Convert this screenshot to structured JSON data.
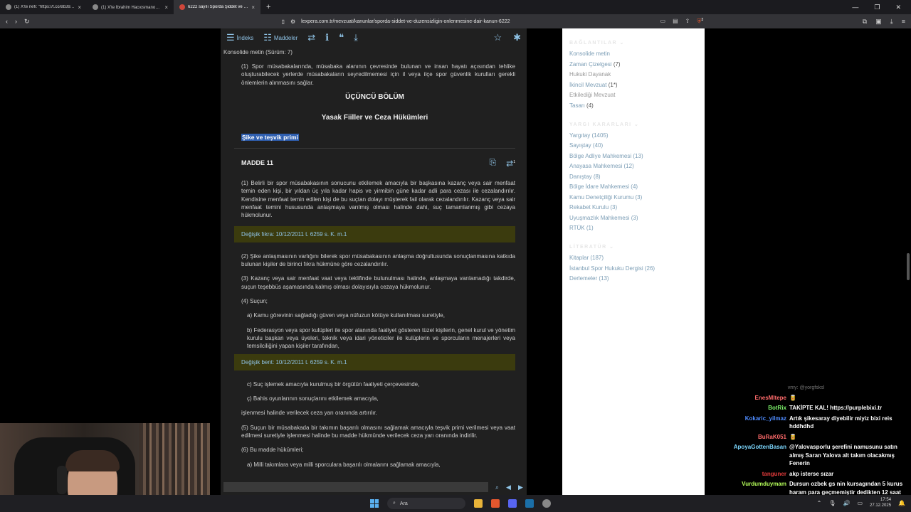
{
  "browser": {
    "tabs": [
      {
        "title": "(1) X'te nefi: \"https://t.co/8b397Hlsi2\"",
        "favicon": "x-icon",
        "active": false
      },
      {
        "title": "(1) X'te İbrahim Hacıosmanoğlu: \"🔴 #Şik...",
        "favicon": "x-icon",
        "active": false
      },
      {
        "title": "6222 sayılı Sporda Şiddet ve Düz...",
        "favicon": "lexpera-icon",
        "active": true
      }
    ],
    "url": "lexpera.com.tr/mevzuat/kanunlar/sporda-siddet-ve-duzensizligin-onlenmesine-dair-kanun-6222",
    "shield_badge": "3"
  },
  "article_toolbar": {
    "index_label": "İndeks",
    "articles_label": "Maddeler"
  },
  "consolidated": "Konsolide metin (Sürüm: 7)",
  "article": {
    "intro_para": "(1) Spor müsabakalarında, müsabaka alanının çevresinde bulunan ve insan hayatı açısından tehlike oluşturabilecek yerlerde müsabakaların seyredilmemesi için il veya ilçe spor güvenlik kurulları gerekli önlemlerin alınmasını sağlar.",
    "chapter": "ÜÇÜNCÜ BÖLÜM",
    "section": "Yasak Fiiller ve Ceza Hükümleri",
    "highlight": "Şike ve teşvik primi",
    "madde": "MADDE 11",
    "madde_badge": "1",
    "p1": "(1) Belirli bir spor müsabakasının sonucunu etkilemek amacıyla bir başkasına kazanç veya sair menfaat temin eden kişi, bir yıldan üç yıla kadar hapis ve yirmibin güne kadar adli para cezası ile cezalandırılır. Kendisine menfaat temin edilen kişi de bu suçtan dolayı müşterek fail olarak cezalandırılır. Kazanç veya sair menfaat temini hususunda anlaşmaya varılmış olması halinde dahi, suç tamamlanmış gibi cezaya hükmolunur.",
    "change1": "Değişik fıkra: 10/12/2011 t. 6259 s. K. m.1",
    "p2": "(2) Şike anlaşmasının varlığını bilerek spor müsabakasının anlaşma doğrultusunda sonuçlanmasına katkıda bulunan kişiler de birinci fıkra hükmüne göre cezalandırılır.",
    "p3": "(3) Kazanç veya sair menfaat vaat veya teklifinde bulunulması halinde, anlaşmaya varılamadığı takdirde, suçun teşebbüs aşamasında kalmış olması dolayısıyla cezaya hükmolunur.",
    "p4": "(4) Suçun;",
    "p4a": "a) Kamu görevinin sağladığı güven veya nüfuzun kötüye kullanılması suretiyle,",
    "p4b": "b) Federasyon veya spor kulüpleri ile spor alanında faaliyet gösteren tüzel kişilerin, genel kurul ve yönetim kurulu başkan veya üyeleri, teknik veya idari yöneticiler ile kulüplerin ve sporcuların menajerleri veya temsilciliğini yapan kişiler tarafından,",
    "change2": "Değişik bent: 10/12/2011 t. 6259 s. K. m.1",
    "p4c": "c) Suç işlemek amacıyla kurulmuş bir örgütün faaliyeti çerçevesinde,",
    "p4c2": "ç) Bahis oyunlarının sonuçlarını etkilemek amacıyla,",
    "p4end": "işlenmesi halinde verilecek ceza yarı oranında artırılır.",
    "p5": "(5) Suçun bir müsabakada bir takımın başarılı olmasını sağlamak amacıyla teşvik primi verilmesi veya vaat edilmesi suretiyle işlenmesi halinde bu madde hükmünde verilecek ceza yarı oranında indirilir.",
    "p6": "(6) Bu madde hükümleri;",
    "p6a": "a) Milli takımlara veya milli sporculara başarılı olmalarını sağlamak amacıyla,"
  },
  "sidebar": {
    "head1": "BAĞLANTILAR ⌄",
    "links": [
      {
        "label": "Konsolide metin",
        "count": "",
        "muted": false
      },
      {
        "label": "Zaman Çizelgesi",
        "count": "(7)",
        "muted": false
      },
      {
        "label": "Hukuki Dayanak",
        "count": "",
        "muted": true
      },
      {
        "label": "İkincil Mevzuat",
        "count": "(1*)",
        "muted": false
      },
      {
        "label": "Etkilediği Mevzuat",
        "count": "",
        "muted": true
      },
      {
        "label": "Tasarı",
        "count": "(4)",
        "muted": false
      }
    ],
    "head2": "YARGI KARARLARI ⌄",
    "rulings": [
      {
        "label": "Yargıtay",
        "count": "(1405)"
      },
      {
        "label": "Sayıştay",
        "count": "(40)"
      },
      {
        "label": "Bölge Adliye Mahkemesi",
        "count": "(13)"
      },
      {
        "label": "Anayasa Mahkemesi",
        "count": "(12)"
      },
      {
        "label": "Danıştay",
        "count": "(8)"
      },
      {
        "label": "Bölge İdare Mahkemesi",
        "count": "(4)"
      },
      {
        "label": "Kamu Denetçiliği Kurumu",
        "count": "(3)"
      },
      {
        "label": "Rekabet Kurulu",
        "count": "(3)"
      },
      {
        "label": "Uyuşmazlık Mahkemesi",
        "count": "(3)"
      },
      {
        "label": "RTÜK",
        "count": "(1)"
      }
    ],
    "head3": "LİTERATÜR ⌄",
    "literature": [
      {
        "label": "Kitaplar",
        "count": "(187)"
      },
      {
        "label": "İstanbul Spor Hukuku Dergisi",
        "count": "(26)"
      },
      {
        "label": "Derlemeler",
        "count": "(13)"
      }
    ]
  },
  "chat": {
    "faded_top": "vmy: @yorgfsksl",
    "messages": [
      {
        "user": "EnesMltepe",
        "color": "#ff6b6b",
        "msg": "🥫"
      },
      {
        "user": "BotRix",
        "color": "#7cf06a",
        "msg": "TAKİPTE KAL! https://purplebixi.tr"
      },
      {
        "user": "Kokaric_yilmaz",
        "color": "#4f8cff",
        "msg": "Artık şikesaray diyebilir miyiz bixi reis hddhdhd"
      },
      {
        "user": "BuRaK051",
        "color": "#ff6b6b",
        "msg": "🥫"
      },
      {
        "user": "ApoyaGottenBasan",
        "color": "#7dd8ff",
        "msg": "@Yalovasporlu şerefini namusunu satın almış Saran Yalova alt takım olacakmış Fenerin"
      },
      {
        "user": "tanguner",
        "color": "#e23b3b",
        "msg": "akp isterse sızar"
      },
      {
        "user": "Vurdumduymam",
        "color": "#b6ff5a",
        "msg": "Dursun ozbek gs nin kursagından 5 kurus haram para geçmemiştir dedikten 12 saat sonra erden timur gözaltına alınıyo aynen gecmem"
      }
    ],
    "faded_bottom": "@wavvyatnymdes"
  },
  "taskbar": {
    "search_label": "Ara",
    "time": "17:54",
    "date": "27.12.2025"
  },
  "colors": {
    "link": "#8fc3e6",
    "highlight_bg": "#2f5fb0",
    "change_bg": "#3b3b0e",
    "article_bg": "#202020"
  }
}
